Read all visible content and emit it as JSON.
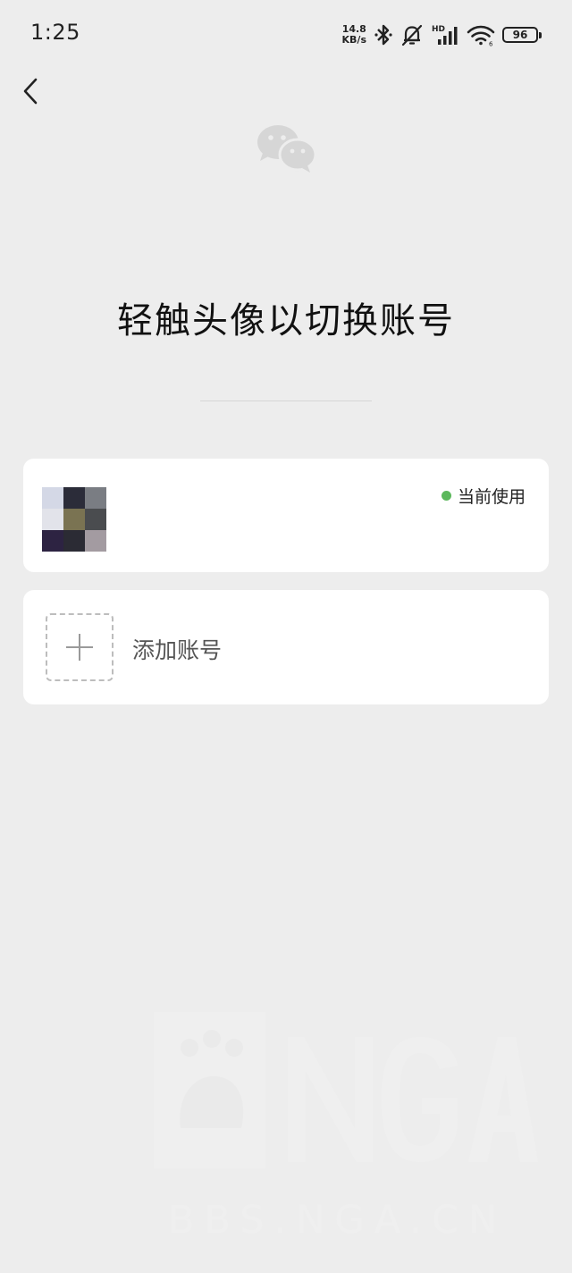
{
  "status_bar": {
    "time": "1:25",
    "net_speed_value": "14.8",
    "net_speed_unit": "KB/s",
    "battery_level": "96",
    "icons": [
      "bluetooth-icon",
      "mute-bell-icon",
      "hd-signal-icon",
      "wifi-icon",
      "battery-icon"
    ]
  },
  "header": {
    "back_icon": "chevron-left-icon",
    "logo_icon": "wechat-logo-icon",
    "title": "轻触头像以切换账号"
  },
  "accounts": [
    {
      "avatar_colors": [
        "#d4d8e6",
        "#2b2c39",
        "#7a7d83",
        "#e2e3ea",
        "#7a7352",
        "#4a4c4f",
        "#2d2342",
        "#2b2b34",
        "#a39ba1"
      ],
      "status_label": "当前使用",
      "status_color": "#5cb85c"
    }
  ],
  "add_account": {
    "label": "添加账号",
    "icon": "plus-icon"
  },
  "watermark": {
    "text": "BBS.NGA.CN"
  }
}
